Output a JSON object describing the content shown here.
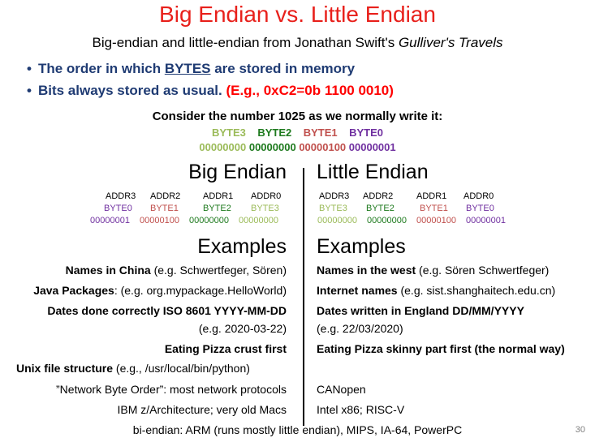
{
  "title": "Big Endian vs. Little Endian",
  "subtitle": {
    "prefix": "Big-endian and little-endian from Jonathan Swift's ",
    "italic": "Gulliver's Travels"
  },
  "bullets": {
    "b1_pre": "The order in which ",
    "b1_u": "BYTES",
    "b1_post": " are stored in memory",
    "b2_pre": "Bits always stored as usual. ",
    "b2_red": "(E.g., 0xC2=0b 1100 0010)",
    "dot": "•"
  },
  "consider": "Consider the number 1025 as we normally write it:",
  "number": {
    "labels": [
      "BYTE3",
      "BYTE2",
      "BYTE1",
      "BYTE0"
    ],
    "bits": [
      "00000000",
      "00000000",
      "00000100",
      "00000001"
    ]
  },
  "big": {
    "heading": "Big Endian",
    "addrs": [
      "ADDR3",
      "ADDR2",
      "ADDR1",
      "ADDR0"
    ],
    "bytes": [
      "BYTE0",
      "BYTE1",
      "BYTE2",
      "BYTE3"
    ],
    "bits": [
      "00000001",
      "00000100",
      "00000000",
      "00000000"
    ]
  },
  "little": {
    "heading": "Little Endian",
    "addrs": [
      "ADDR3",
      "ADDR2",
      "ADDR1",
      "ADDR0"
    ],
    "bytes": [
      "BYTE3",
      "BYTE2",
      "BYTE1",
      "BYTE0"
    ],
    "bits": [
      "00000000",
      "00000000",
      "00000100",
      "00000001"
    ]
  },
  "examples_heading": "Examples",
  "left_rows": [
    {
      "bold": "Names in China",
      "rest": " (e.g. Schwertfeger, Sören)"
    },
    {
      "bold": "Java Packages",
      "rest": ": (e.g. org.mypackage.HelloWorld)"
    },
    {
      "bold": "Dates done correctly ISO 8601 YYYY-MM-DD",
      "rest": ""
    },
    {
      "bold": "",
      "rest": "(e.g. 2020-03-22)"
    },
    {
      "bold": "Eating Pizza crust first",
      "rest": ""
    },
    {
      "bold": "Unix file structure",
      "rest": " (e.g., /usr/local/bin/python)"
    },
    {
      "bold": "",
      "rest": "”Network Byte Order”: most network protocols"
    },
    {
      "bold": "",
      "rest": "IBM z/Architecture; very old Macs"
    }
  ],
  "right_rows": [
    {
      "bold": "Names in the west",
      "rest": " (e.g. Sören Schwertfeger)"
    },
    {
      "bold": "Internet names",
      "rest": " (e.g. sist.shanghaitech.edu.cn)"
    },
    {
      "bold": "Dates written in England DD/MM/YYYY",
      "rest": ""
    },
    {
      "bold": "",
      "rest": "(e.g. 22/03/2020)"
    },
    {
      "bold": "Eating Pizza skinny part first (the normal way)",
      "rest": ""
    },
    {
      "bold": "",
      "rest": ""
    },
    {
      "bold": "",
      "rest": "CANopen"
    },
    {
      "bold": "",
      "rest": "Intel x86; RISC-V"
    }
  ],
  "footer": "bi-endian: ARM (runs mostly little endian), MIPS, IA-64, PowerPC",
  "page_number": "30",
  "colors": {
    "title": "#e8201b",
    "bullet": "#1f3b73",
    "byte3": "#9bbb59",
    "byte2": "#1e7a1e",
    "byte1": "#c0504d",
    "byte0": "#7030a0"
  }
}
